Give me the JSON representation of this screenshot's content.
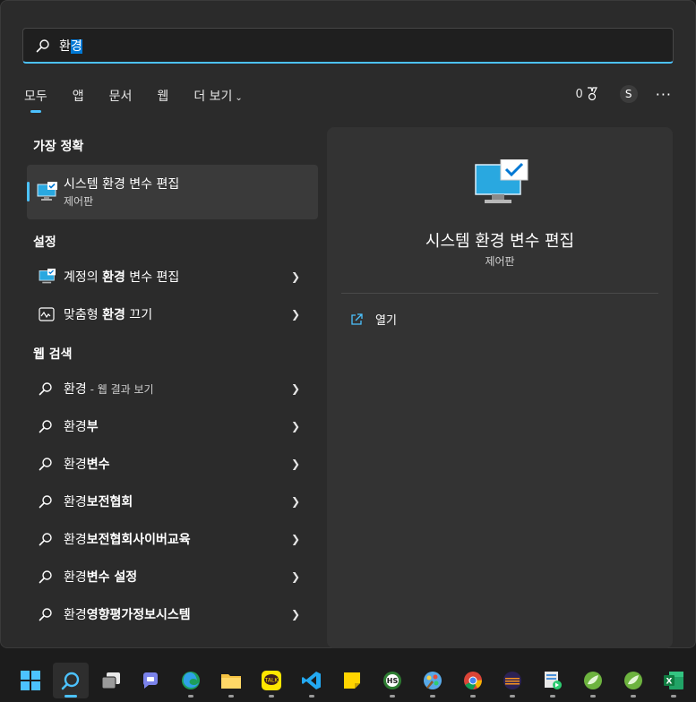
{
  "search": {
    "query_prefix": "환",
    "query_selected": "경"
  },
  "tabs": [
    {
      "label": "모두",
      "active": true
    },
    {
      "label": "앱"
    },
    {
      "label": "문서"
    },
    {
      "label": "웹"
    },
    {
      "label": "더 보기"
    }
  ],
  "toolbar": {
    "points": "0",
    "avatar_initial": "S",
    "more": "···"
  },
  "best_match": {
    "section_title": "가장 정확",
    "title": "시스템 환경 변수 편집",
    "subtitle": "제어판"
  },
  "settings": {
    "section_title": "설정",
    "items": [
      {
        "pre": "계정의 ",
        "bold": "환경",
        "post": " 변수 편집"
      },
      {
        "pre": "맞춤형 ",
        "bold": "환경",
        "post": " 끄기"
      }
    ]
  },
  "web": {
    "section_title": "웹 검색",
    "items": [
      {
        "pre": "",
        "bold": "",
        "post": "환경",
        "suffix": " - 웹 결과 보기"
      },
      {
        "pre": "환경",
        "bold": "부",
        "post": ""
      },
      {
        "pre": "환경",
        "bold": "변수",
        "post": ""
      },
      {
        "pre": "환경",
        "bold": "보전협회",
        "post": ""
      },
      {
        "pre": "환경",
        "bold": "보전협회사이버교육",
        "post": ""
      },
      {
        "pre": "환경",
        "bold": "변수 설정",
        "post": ""
      },
      {
        "pre": "환경",
        "bold": "영향평가정보시스템",
        "post": ""
      }
    ]
  },
  "detail": {
    "title": "시스템 환경 변수 편집",
    "subtitle": "제어판",
    "open_label": "열기"
  },
  "taskbar": [
    "windows-start",
    "search",
    "task-view",
    "teams-chat",
    "edge",
    "file-explorer",
    "kakaotalk",
    "vs-code",
    "sticky-notes",
    "hancom",
    "paint",
    "chrome",
    "eclipse",
    "remote-app",
    "spring-tool-suite",
    "spring-tool-suite-2",
    "excel"
  ],
  "colors": {
    "accent": "#4cc2ff",
    "panel": "#2b2b2b",
    "detail_panel": "#333333"
  }
}
